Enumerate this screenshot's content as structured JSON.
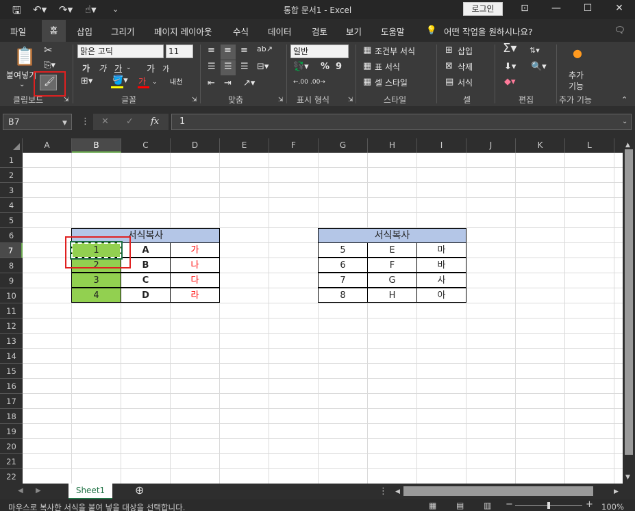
{
  "window": {
    "title": "통합 문서1  -  Excel",
    "login": "로그인"
  },
  "tabs": [
    "파일",
    "홈",
    "삽입",
    "그리기",
    "페이지 레이아웃",
    "수식",
    "데이터",
    "검토",
    "보기",
    "도움말"
  ],
  "tell_me": "어떤 작업을 원하시나요?",
  "ribbon": {
    "clipboard": {
      "paste": "붙여넣기",
      "label": "클립보드"
    },
    "font": {
      "name": "맑은 고딕",
      "size": "11",
      "label": "글꼴",
      "grow": "가",
      "shrink": "가",
      "underline_glyph": "가",
      "phonetic": "내천"
    },
    "align": {
      "label": "맞춤"
    },
    "number": {
      "format": "일반",
      "percent": "%",
      "comma": "9",
      "label": "표시 형식"
    },
    "styles": {
      "conditional": "조건부 서식",
      "table": "표 서식",
      "cell": "셀 스타일",
      "label": "스타일"
    },
    "cells": {
      "insert": "삽입",
      "delete": "삭제",
      "format": "서식",
      "label": "셀"
    },
    "editing": {
      "label": "편집"
    },
    "addins": {
      "button": "추가\n기능",
      "button_line1": "추가",
      "button_line2": "기능",
      "label": "추가 기능"
    }
  },
  "formula_bar": {
    "name_box": "B7",
    "fx": "fx",
    "value": "1"
  },
  "columns": [
    "A",
    "B",
    "C",
    "D",
    "E",
    "F",
    "G",
    "H",
    "I",
    "J",
    "K",
    "L"
  ],
  "rows": [
    "1",
    "2",
    "3",
    "4",
    "5",
    "6",
    "7",
    "8",
    "9",
    "10",
    "11",
    "12",
    "13",
    "14",
    "15",
    "16",
    "17",
    "18",
    "19",
    "20",
    "21",
    "22"
  ],
  "table_left": {
    "header": "서식복사",
    "rows": [
      {
        "num": "1",
        "letter": "A",
        "kor": "가"
      },
      {
        "num": "2",
        "letter": "B",
        "kor": "나"
      },
      {
        "num": "3",
        "letter": "C",
        "kor": "다"
      },
      {
        "num": "4",
        "letter": "D",
        "kor": "라"
      }
    ]
  },
  "table_right": {
    "header": "서식복사",
    "rows": [
      {
        "num": "5",
        "letter": "E",
        "kor": "마"
      },
      {
        "num": "6",
        "letter": "F",
        "kor": "바"
      },
      {
        "num": "7",
        "letter": "G",
        "kor": "사"
      },
      {
        "num": "8",
        "letter": "H",
        "kor": "아"
      }
    ]
  },
  "sheet": {
    "tab": "Sheet1"
  },
  "status": {
    "message": "마우스로 복사한 서식을 붙여 넣을 대상을 선택합니다.",
    "zoom": "100%"
  },
  "colors": {
    "accent_green": "#92d050",
    "header_blue": "#b4c6e7",
    "red_text": "#ff0000",
    "highlight_red": "#e02020"
  }
}
